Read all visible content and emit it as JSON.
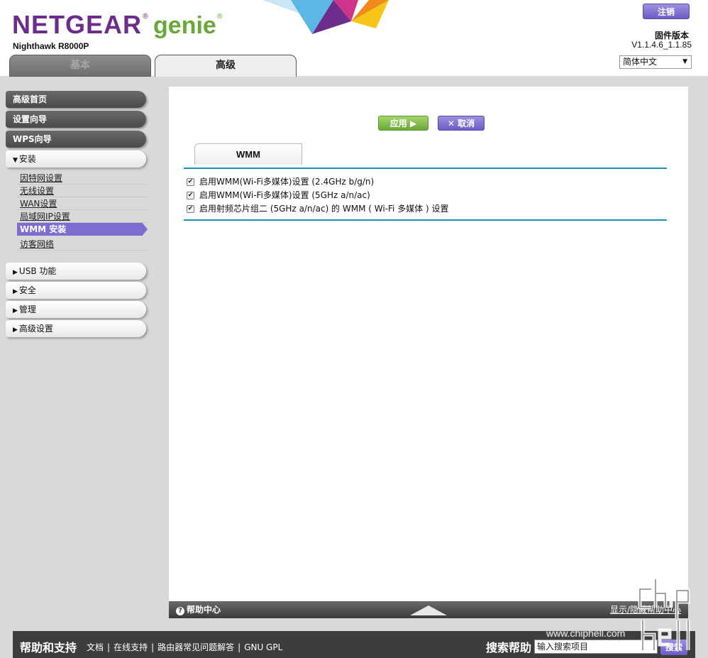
{
  "header": {
    "brand": "NETGEAR",
    "product": "genie",
    "reg": "®",
    "model": "Nighthawk R8000P",
    "logout_label": "注销",
    "firmware_label": "固件版本",
    "firmware_version": "V1.1.4.6_1.1.85",
    "language": "简体中文",
    "decor_colors": [
      "#5bb7e6",
      "#6b2c8c",
      "#f08a1c",
      "#f5c518",
      "#d0338b"
    ]
  },
  "tabs": [
    {
      "label": "基本"
    },
    {
      "label": "高级"
    }
  ],
  "sidebar": {
    "top_items": [
      {
        "label": "高级首页"
      },
      {
        "label": "设置向导"
      },
      {
        "label": "WPS向导"
      }
    ],
    "expanded": {
      "label": "安装",
      "arrow": "▼",
      "items": [
        {
          "label": "因特网设置"
        },
        {
          "label": "无线设置"
        },
        {
          "label": "WAN设置"
        },
        {
          "label": "局域网IP设置"
        },
        {
          "label": "WMM 安装"
        },
        {
          "label": "访客网络"
        }
      ]
    },
    "collapsed": [
      {
        "label": "USB 功能"
      },
      {
        "label": "安全"
      },
      {
        "label": "管理"
      },
      {
        "label": "高级设置"
      }
    ],
    "collapsed_arrow": "▶"
  },
  "main": {
    "apply_label": "应用 ▶",
    "cancel_label": "✕ 取消",
    "section_tab": "WMM",
    "options": [
      {
        "label": "启用WMM(Wi-Fi多媒体)设置 (2.4GHz b/g/n)",
        "checked": true
      },
      {
        "label": "启用WMM(Wi-Fi多媒体)设置 (5GHz a/n/ac)",
        "checked": true
      },
      {
        "label": "启用射频芯片组二 (5GHz a/n/ac) 的 WMM ( Wi-Fi 多媒体 ) 设置",
        "checked": true
      }
    ],
    "checkmark": "✔",
    "accent_color": "#1f8fbf"
  },
  "helpbar": {
    "label": "帮助中心",
    "q": "?",
    "toggle": "显示/隐藏帮助中心"
  },
  "footer": {
    "title": "帮助和支持",
    "links": [
      "文档",
      "在线支持",
      "路由器常见问题解答",
      "GNU GPL"
    ],
    "search_title": "搜索帮助",
    "search_value": "输入搜索项目",
    "search_button": "搜索"
  },
  "watermark": {
    "text": "www.chiphell.com"
  }
}
